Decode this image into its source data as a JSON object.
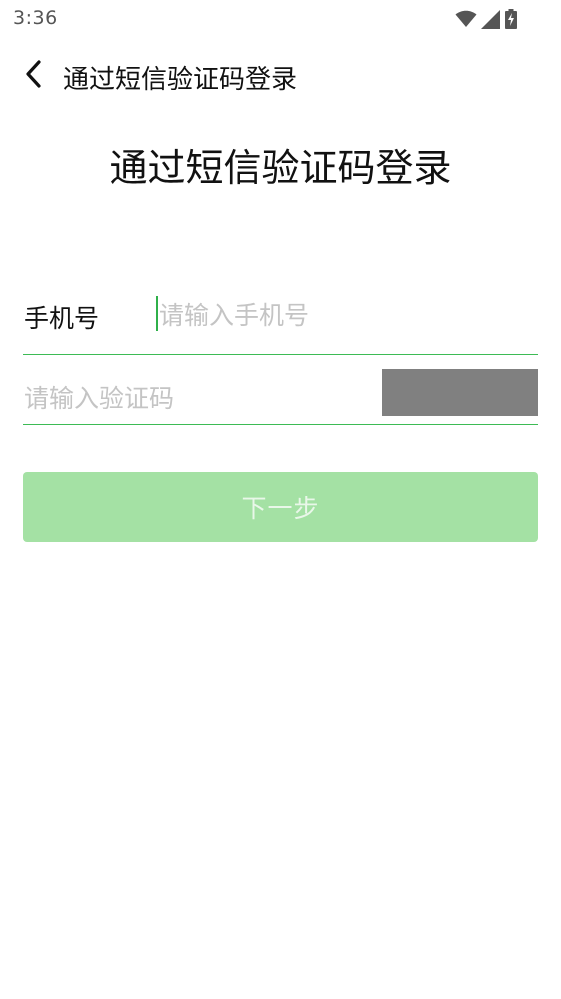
{
  "status_bar": {
    "time": "3:36",
    "icons": [
      "wifi-icon",
      "signal-icon",
      "battery-charging-icon"
    ]
  },
  "top_bar": {
    "back_icon": "chevron-left-icon",
    "title": "通过短信验证码登录"
  },
  "heading": "通过短信验证码登录",
  "phone": {
    "label": "手机号",
    "value": "",
    "placeholder": "请输入手机号"
  },
  "code": {
    "value": "",
    "placeholder": "请输入验证码",
    "button_label": ""
  },
  "next_button": {
    "label": "下一步"
  },
  "colors": {
    "accent": "#3dbb55",
    "button_disabled": "#a4e1a4",
    "code_button": "#808080",
    "placeholder": "#c4c4c4"
  }
}
